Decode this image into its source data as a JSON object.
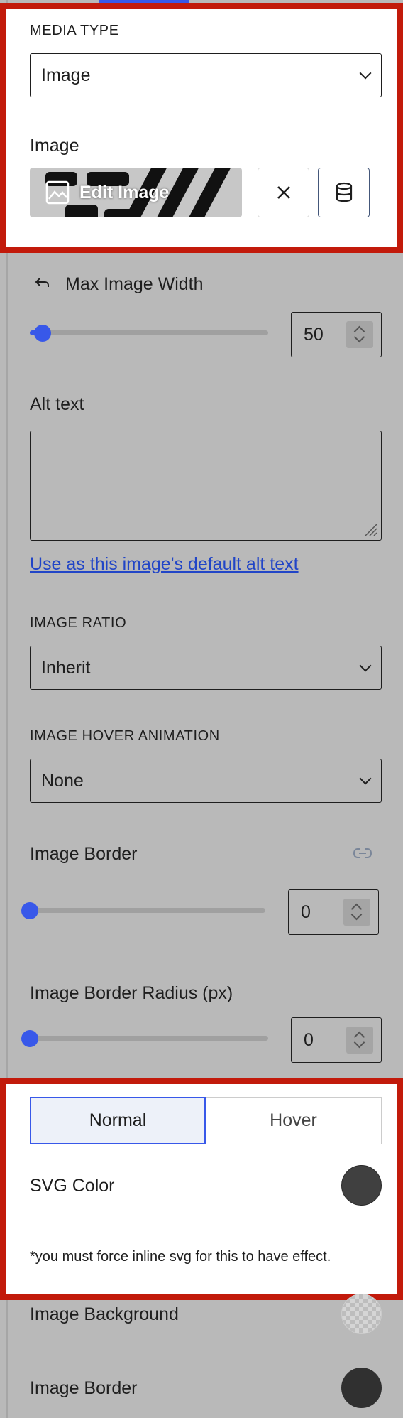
{
  "media_type": {
    "heading": "MEDIA TYPE",
    "value": "Image"
  },
  "image": {
    "label": "Image",
    "edit_label": "Edit Image",
    "clear_icon": "close-icon",
    "library_icon": "database-icon"
  },
  "max_width": {
    "label": "Max Image Width",
    "value": "50",
    "slider_fraction": 0.03,
    "reset_icon": "undo-arrow-icon"
  },
  "alt_text": {
    "label": "Alt text",
    "value": "",
    "link": "Use as this image's default alt text"
  },
  "image_ratio": {
    "heading": "IMAGE RATIO",
    "value": "Inherit"
  },
  "hover_animation": {
    "heading": "IMAGE HOVER ANIMATION",
    "value": "None"
  },
  "image_border": {
    "label": "Image Border",
    "value": "0",
    "slider_fraction": 0,
    "link_icon": "link-icon"
  },
  "border_radius": {
    "label": "Image Border Radius (px)",
    "value": "0",
    "slider_fraction": 0
  },
  "state_tabs": {
    "normal": "Normal",
    "hover": "Hover",
    "active": "normal"
  },
  "svg_color": {
    "label": "SVG Color",
    "color": "#404040"
  },
  "note": "*you must force inline svg for this to have effect.",
  "image_background": {
    "label": "Image Background",
    "color": "transparent"
  },
  "image_border_color": {
    "label": "Image Border",
    "color": "#303030"
  },
  "colors": {
    "accent": "#3858e9",
    "highlight_border": "#c21a0b",
    "link": "#2145c7"
  }
}
